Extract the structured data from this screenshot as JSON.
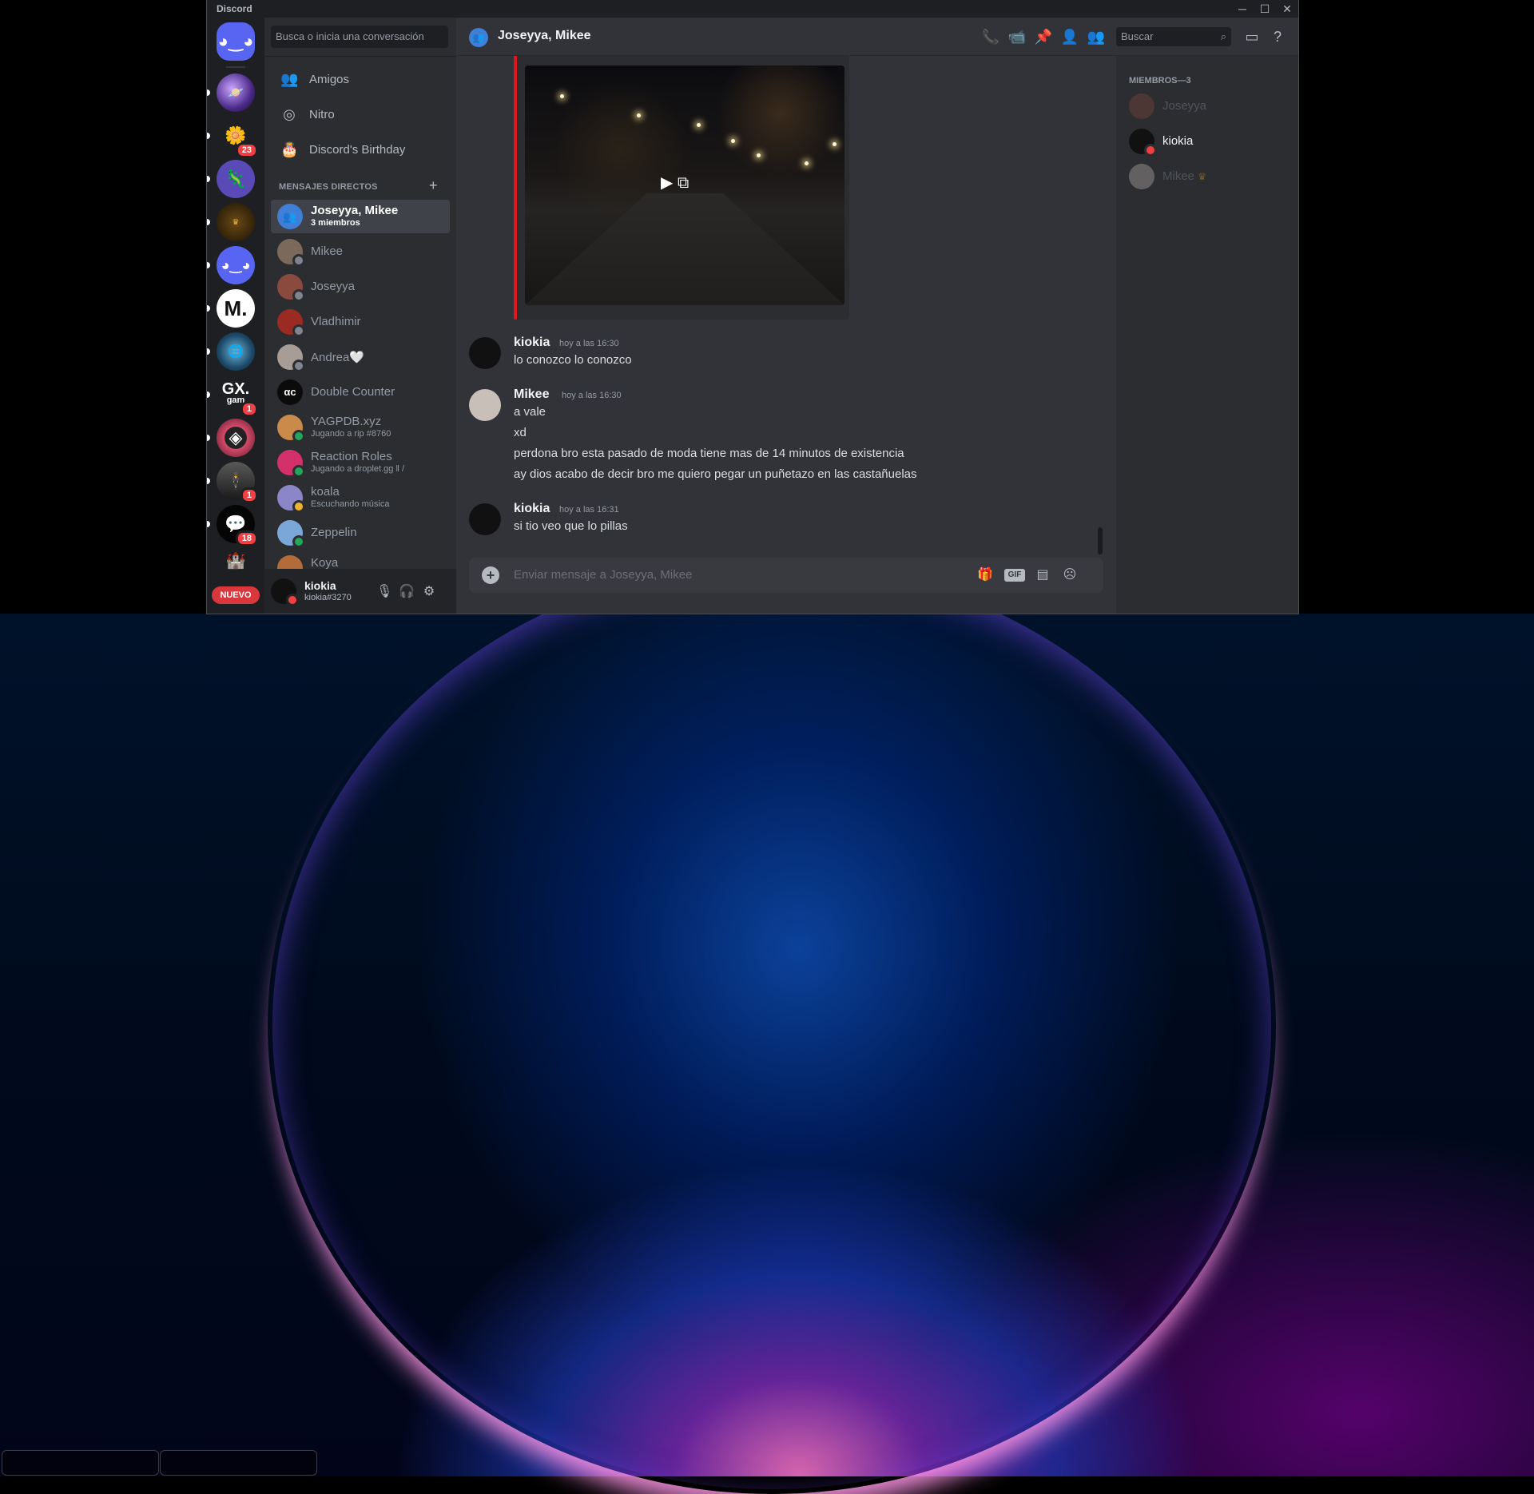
{
  "window": {
    "title": "Discord",
    "controls": [
      "minimize",
      "maximize",
      "close"
    ]
  },
  "rail": {
    "servers": [
      {
        "name": "home",
        "badge": ""
      },
      {
        "name": "planet-server",
        "badge": ""
      },
      {
        "name": "flower-server",
        "badge": "23"
      },
      {
        "name": "axolotl-server",
        "badge": ""
      },
      {
        "name": "lida-server",
        "badge": ""
      },
      {
        "name": "discord-server",
        "badge": ""
      },
      {
        "name": "m-server",
        "badge": ""
      },
      {
        "name": "globe-server",
        "badge": ""
      },
      {
        "name": "gx-server",
        "badge": "1"
      },
      {
        "name": "diamond-server",
        "badge": ""
      },
      {
        "name": "suit-server",
        "badge": "1"
      },
      {
        "name": "chat-server",
        "badge": "18"
      }
    ],
    "gx_text": "GX.",
    "gx_sub": "gam",
    "m_text": "M.",
    "nuevo": "NUEVO"
  },
  "dm_sidebar": {
    "search_placeholder": "Busca o inicia una conversación",
    "nav": [
      "Amigos",
      "Nitro",
      "Discord's Birthday"
    ],
    "header": "MENSAJES DIRECTOS",
    "dms": [
      {
        "name": "Joseyya, Mikee",
        "sub": "3 miembros",
        "active": true,
        "color": "#3f7fd6"
      },
      {
        "name": "Mikee",
        "sub": "",
        "color": "#7b6a5c"
      },
      {
        "name": "Joseyya",
        "sub": "",
        "color": "#8a4b3e"
      },
      {
        "name": "Vladhimir",
        "sub": "",
        "color": "#9b2a22"
      },
      {
        "name": "Andrea🤍",
        "sub": "",
        "color": "#a79c96"
      },
      {
        "name": "Double Counter",
        "sub": "",
        "color": "#0b0b0b"
      },
      {
        "name": "YAGPDB.xyz",
        "sub": "Jugando a rip #8760",
        "color": "#c98a4a"
      },
      {
        "name": "Reaction Roles",
        "sub": "Jugando a droplet.gg ‖ /",
        "color": "#d4306a"
      },
      {
        "name": "koala",
        "sub": "Escuchando música",
        "color": "#8a86c8"
      },
      {
        "name": "Zeppelin",
        "sub": "",
        "color": "#7aa6d8"
      },
      {
        "name": "Koya",
        "sub": "",
        "color": "#b36b3a"
      }
    ]
  },
  "user": {
    "name": "kiokia",
    "tag": "kiokia#3270"
  },
  "chat": {
    "title": "Joseyya, Mikee",
    "search_placeholder": "Buscar",
    "messages": [
      {
        "author": "kiokia",
        "time": "hoy a las 16:30",
        "lines": [
          "lo conozco lo conozco"
        ]
      },
      {
        "author": "Mikee",
        "time": "hoy a las 16:30",
        "lines": [
          "a vale",
          "xd",
          "perdona bro esta pasado de moda tiene mas de 14 minutos de existencia",
          "ay dios acabo de decir bro me quiero pegar un puñetazo en las castañuelas"
        ]
      },
      {
        "author": "kiokia",
        "time": "hoy a las 16:31",
        "lines": [
          "si tio veo que lo pillas"
        ]
      }
    ],
    "composer_placeholder": "Enviar mensaje a Joseyya, Mikee",
    "gif_label": "GIF"
  },
  "members": {
    "header": "MIEMBROS—3",
    "list": [
      {
        "name": "Joseyya",
        "offline": true,
        "color": "#8a4b3e"
      },
      {
        "name": "kiokia",
        "offline": false,
        "color": "#111111"
      },
      {
        "name": "Mikee",
        "offline": true,
        "color": "#7b6a5c",
        "crown": "♛"
      }
    ]
  }
}
